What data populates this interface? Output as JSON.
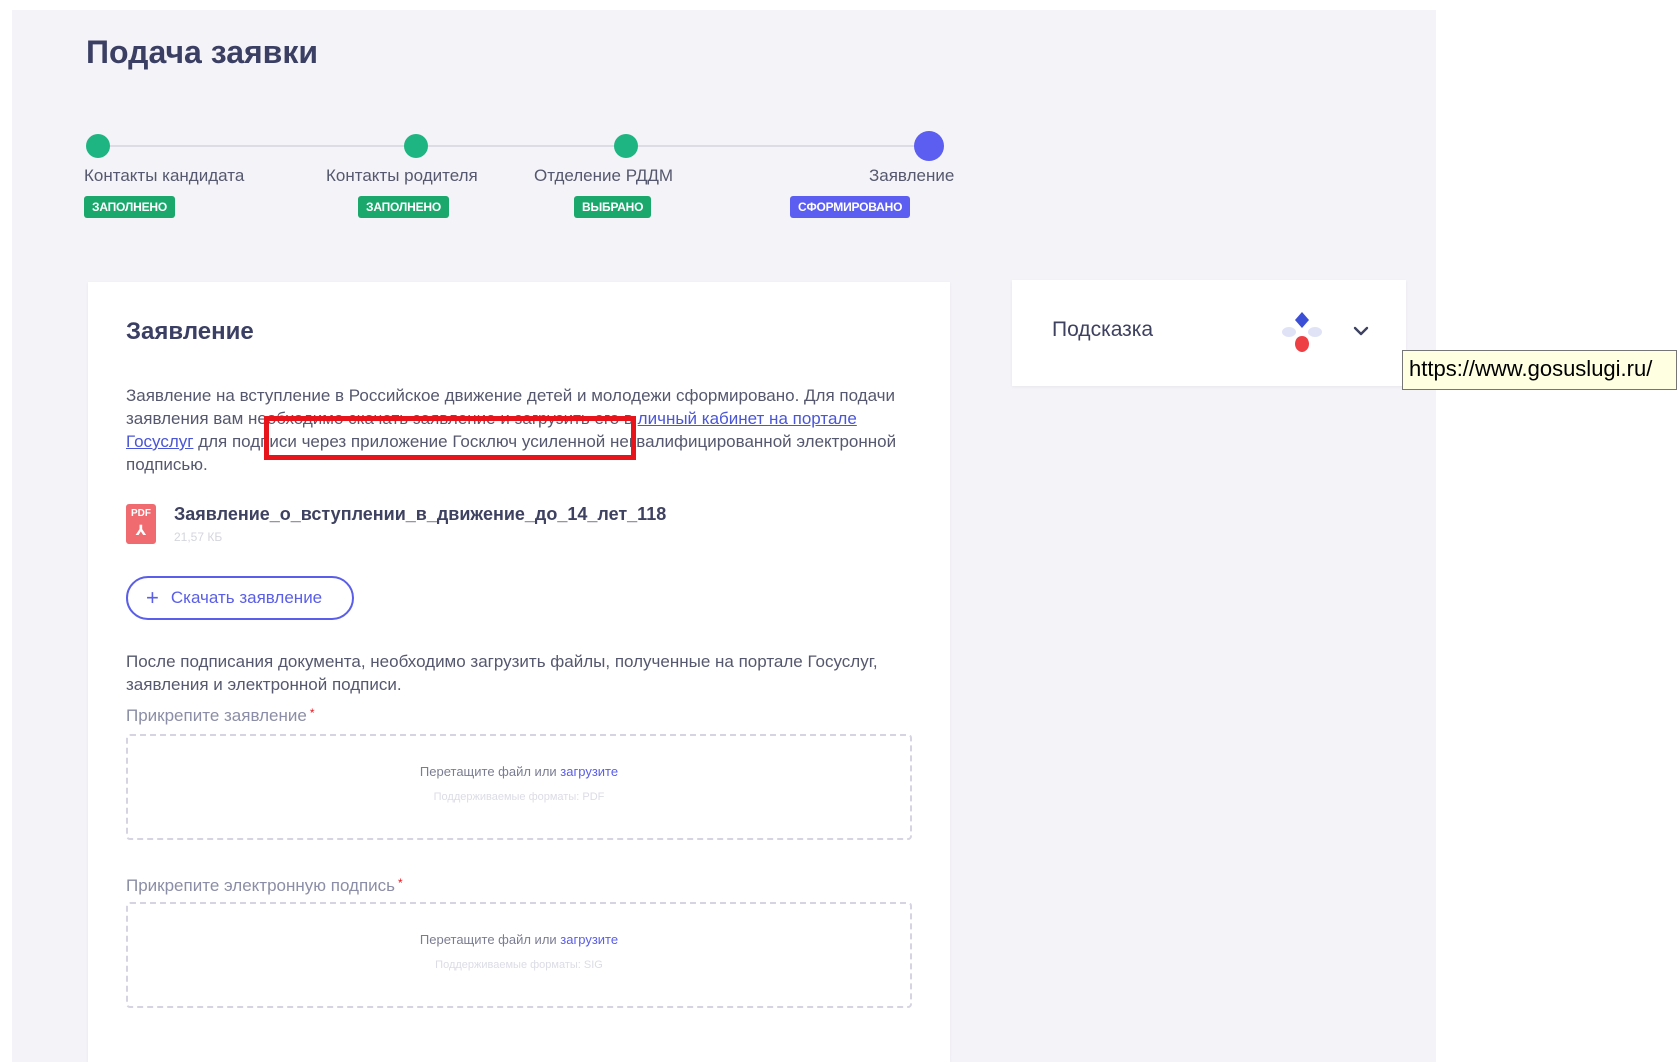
{
  "page": {
    "title": "Подача заявки"
  },
  "stepper": {
    "steps": [
      {
        "label": "Контакты кандидата",
        "badge": "ЗАПОЛНЕНО"
      },
      {
        "label": "Контакты родителя",
        "badge": "ЗАПОЛНЕНО"
      },
      {
        "label": "Отделение РДДМ",
        "badge": "ВЫБРАНО"
      },
      {
        "label": "Заявление",
        "badge": "СФОРМИРОВАНО"
      }
    ]
  },
  "statement": {
    "title": "Заявление",
    "intro_part1": "Заявление на вступление в Российское движение детей и молодежи сформировано. Для подачи заявления вам необходимо скачать заявление и загрузить его в ",
    "intro_link": "личный кабинет на портале Госуслуг",
    "intro_part2": " для подписи через приложение Госключ усиленной неквалифицированной электронной подписью.",
    "file": {
      "icon": "pdf-icon",
      "icon_label": "PDF",
      "name": "Заявление_о_вступлении_в_движение_до_14_лет_118",
      "size": "21,57 КБ"
    },
    "download_button": "Скачать заявление",
    "after_sign_text": "После подписания документа, необходимо загрузить файлы, полученные на портале Госуслуг, заявления и электронной подписи.",
    "attach_statement": {
      "label": "Прикрепите заявление",
      "required_mark": "*",
      "drop_text": "Перетащите файл или",
      "upload_link": "загрузите",
      "formats": "Поддерживаемые форматы: PDF"
    },
    "attach_signature": {
      "label": "Прикрепите электронную подпись",
      "required_mark": "*",
      "drop_text": "Перетащите файл или",
      "upload_link": "загрузите",
      "formats": "Поддерживаемые форматы: SIG"
    }
  },
  "hint": {
    "title": "Подсказка",
    "logo_icon": "gosuslugi-logo-icon",
    "toggle_icon": "chevron-down-icon"
  },
  "tooltip": {
    "text": "https://www.gosuslugi.ru/"
  },
  "colors": {
    "accent": "#5b5ef0",
    "success": "#1aa86c",
    "highlight": "#e8141b"
  }
}
